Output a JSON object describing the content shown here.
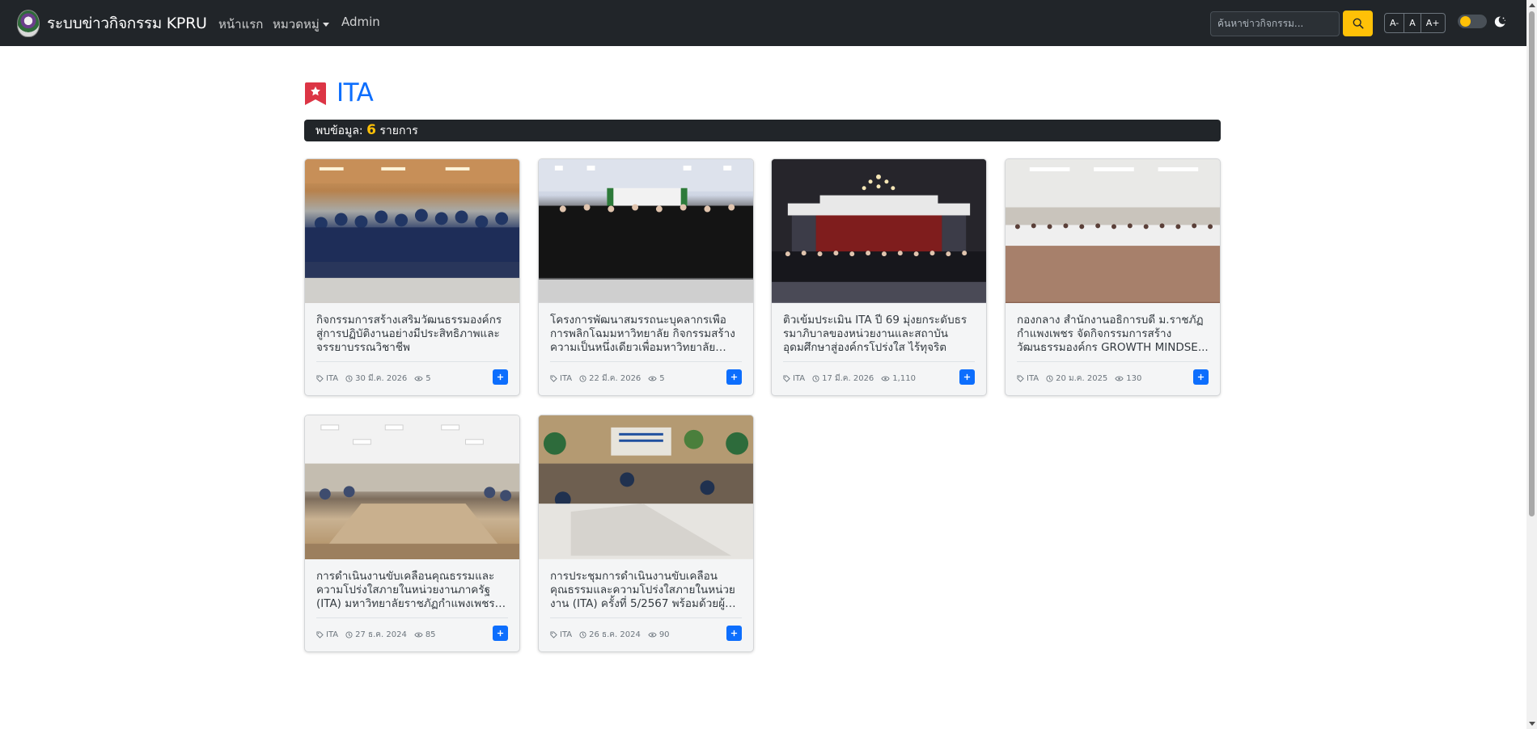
{
  "navbar": {
    "brand": "ระบบข่าวกิจกรรม KPRU",
    "home": "หน้าแรก",
    "categories": "หมวดหมู่",
    "admin": "Admin",
    "search_placeholder": "ค้นหาข่าวกิจกรรม...",
    "font_smaller": "A-",
    "font_normal": "A",
    "font_larger": "A+",
    "accent_color": "#ffc107",
    "nav_bg": "#212529"
  },
  "page": {
    "title": "ITA",
    "result_prefix": "พบข้อมูล:",
    "result_count": "6",
    "result_suffix": "รายการ",
    "title_color": "#0d6efd"
  },
  "cards": [
    {
      "title": "กิจกรรมการสร้างเสริมวัฒนธรรมองค์กรสู่การปฏิบัติงานอย่างมีประสิทธิภาพและจรรยาบรรณวิชาชีพ",
      "tag": "ITA",
      "date": "30 มี.ค. 2026",
      "views": "5"
    },
    {
      "title": "โครงการพัฒนาสมรรถนะบุคลากรเพื่อการพลิกโฉมมหาวิทยาลัย กิจกรรมสร้างความเป็นหนึ่งเดียวเพื่อมหาวิทยาลัย ONE...",
      "tag": "ITA",
      "date": "22 มี.ค. 2026",
      "views": "5"
    },
    {
      "title": "ติวเข้มประเมิน ITA ปี 69 มุ่งยกระดับธรรมาภิบาลของหน่วยงานและสถาบันอุดมศึกษาสู่องค์กรโปร่งใส ไร้ทุจริต",
      "tag": "ITA",
      "date": "17 มี.ค. 2026",
      "views": "1,110"
    },
    {
      "title": "กองกลาง สำนักงานอธิการบดี ม.ราชภัฏกำแพงเพชร จัดกิจกรรมการสร้างวัฒนธรรมองค์กร GROWTH MINDSE...",
      "tag": "ITA",
      "date": "20 ม.ค. 2025",
      "views": "130"
    },
    {
      "title": "การดำเนินงานขับเคลื่อนคุณธรรมและความโปร่งใสภายในหน่วยงานภาครัฐ (ITA) มหาวิทยาลัยราชภัฏกำแพงเพชร ผู้ช่วย...",
      "tag": "ITA",
      "date": "27 ธ.ค. 2024",
      "views": "85"
    },
    {
      "title": "การประชุมการดำเนินงานขับเคลื่อนคุณธรรมและความโปร่งใสภายในหน่วยงาน (ITA) ครั้งที่ 5/2567 พร้อมด้วยผู้ช่วย...",
      "tag": "ITA",
      "date": "26 ธ.ค. 2024",
      "views": "90"
    }
  ]
}
